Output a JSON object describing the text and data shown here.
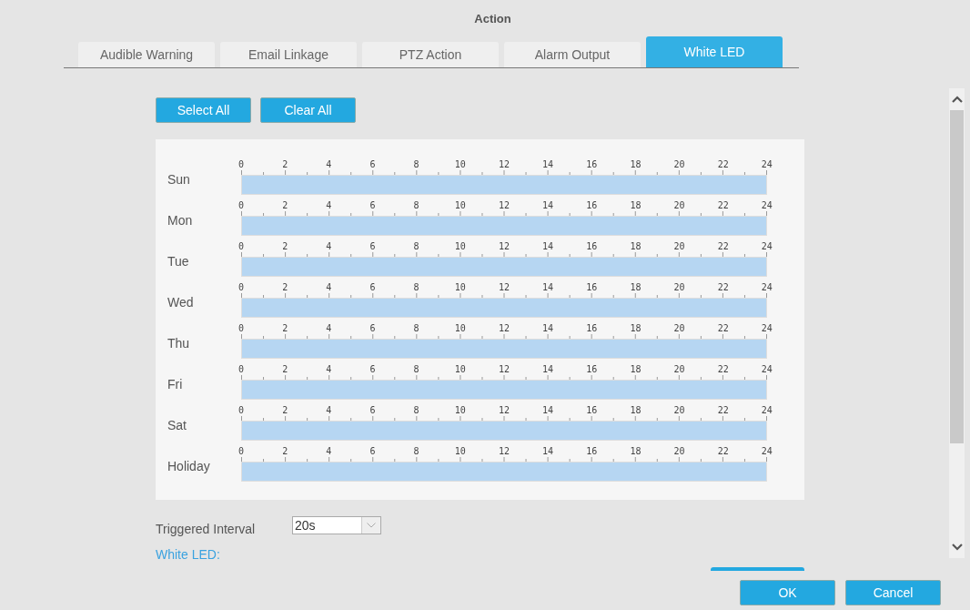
{
  "title": "Action",
  "tabs": [
    {
      "label": "Audible Warning",
      "selected": false
    },
    {
      "label": "Email Linkage",
      "selected": false
    },
    {
      "label": "PTZ Action",
      "selected": false
    },
    {
      "label": "Alarm Output",
      "selected": false
    },
    {
      "label": "White LED",
      "selected": true
    }
  ],
  "schedule_buttons": [
    "Select All",
    "Clear All"
  ],
  "schedule": [
    {
      "day": "Sun",
      "level": 1,
      "hours": [
        "0",
        "2",
        "4",
        "6",
        "8",
        "10",
        "12",
        "14",
        "16",
        "18",
        "20",
        "22",
        "24"
      ]
    },
    {
      "day": "Mon",
      "level": 1,
      "hours": [
        "0",
        "2",
        "4",
        "6",
        "8",
        "10",
        "12",
        "14",
        "16",
        "18",
        "20",
        "22",
        "24"
      ]
    },
    {
      "day": "Tue",
      "level": 1,
      "hours": [
        "0",
        "2",
        "4",
        "6",
        "8",
        "10",
        "12",
        "14",
        "16",
        "18",
        "20",
        "22",
        "24"
      ]
    },
    {
      "day": "Wed",
      "level": 1,
      "hours": [
        "0",
        "2",
        "4",
        "6",
        "8",
        "10",
        "12",
        "14",
        "16",
        "18",
        "20",
        "22",
        "24"
      ]
    },
    {
      "day": "Thu",
      "level": 1,
      "hours": [
        "0",
        "2",
        "4",
        "6",
        "8",
        "10",
        "12",
        "14",
        "16",
        "18",
        "20",
        "22",
        "24"
      ]
    },
    {
      "day": "Fri",
      "level": 1,
      "hours": [
        "0",
        "2",
        "4",
        "6",
        "8",
        "10",
        "12",
        "14",
        "16",
        "18",
        "20",
        "22",
        "24"
      ]
    },
    {
      "day": "Sat",
      "level": 1,
      "hours": [
        "0",
        "2",
        "4",
        "6",
        "8",
        "10",
        "12",
        "14",
        "16",
        "18",
        "20",
        "22",
        "24"
      ]
    },
    {
      "day": "Holiday",
      "level": 1,
      "hours": [
        "0",
        "2",
        "4",
        "6",
        "8",
        "10",
        "12",
        "14",
        "16",
        "18",
        "20",
        "22",
        "24"
      ]
    }
  ],
  "triggered_interval": {
    "label": "Triggered Interval",
    "value": "20s"
  },
  "section_heading": "White LED:",
  "buttons": [
    "OK",
    "Cancel"
  ]
}
